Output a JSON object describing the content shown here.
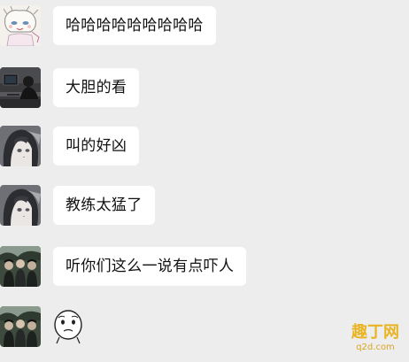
{
  "chat": {
    "messages": [
      {
        "text": "哈哈哈哈哈哈哈哈哈",
        "avatar": "anime-doodle-avatar"
      },
      {
        "text": "大胆的看",
        "avatar": "desk-photo-avatar"
      },
      {
        "text": "叫的好凶",
        "avatar": "anime-girl-avatar"
      },
      {
        "text": "教练太猛了",
        "avatar": "anime-girl-avatar"
      },
      {
        "text": "听你们这么一说有点吓人",
        "avatar": "group-photo-avatar"
      },
      {
        "sticker": "meme-face-sticker",
        "avatar": "group-photo-avatar"
      }
    ]
  },
  "watermark": {
    "cn": "趣丁网",
    "en": "q2d.com"
  },
  "colors": {
    "background": "#ededed",
    "bubble": "#ffffff",
    "text": "#111111",
    "watermark": "#e8b422"
  }
}
